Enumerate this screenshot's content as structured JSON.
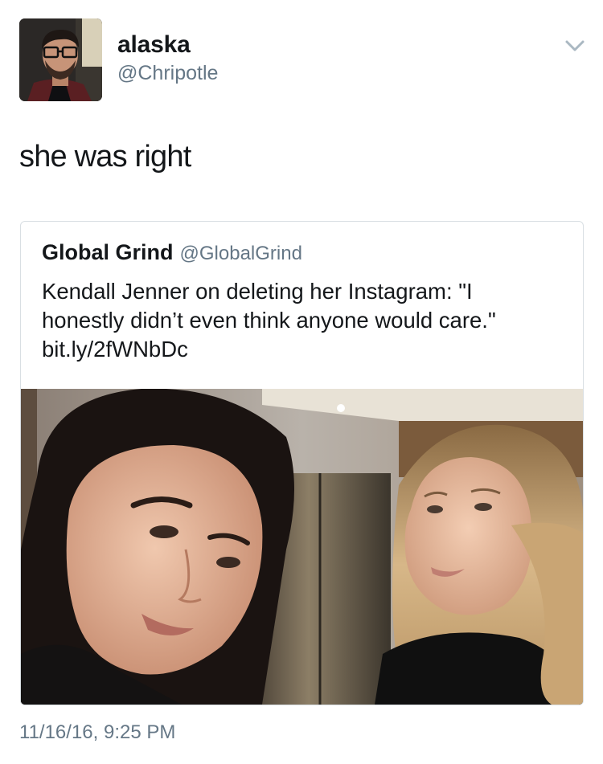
{
  "author": {
    "display_name": "alaska",
    "username": "@Chripotle",
    "avatar_icon": "profile-photo"
  },
  "tweet": {
    "text": "she was right",
    "timestamp": "11/16/16, 9:25 PM",
    "menu_icon": "chevron-down-icon"
  },
  "quote": {
    "display_name": "Global Grind",
    "username": "@GlobalGrind",
    "text": "Kendall Jenner on deleting her Instagram: \"I honestly didn’t even think anyone would care.\" bit.ly/2fWNbDc",
    "media_icon": "photo"
  },
  "colors": {
    "text": "#14171a",
    "secondary": "#657786",
    "border": "#d9dfe3"
  }
}
